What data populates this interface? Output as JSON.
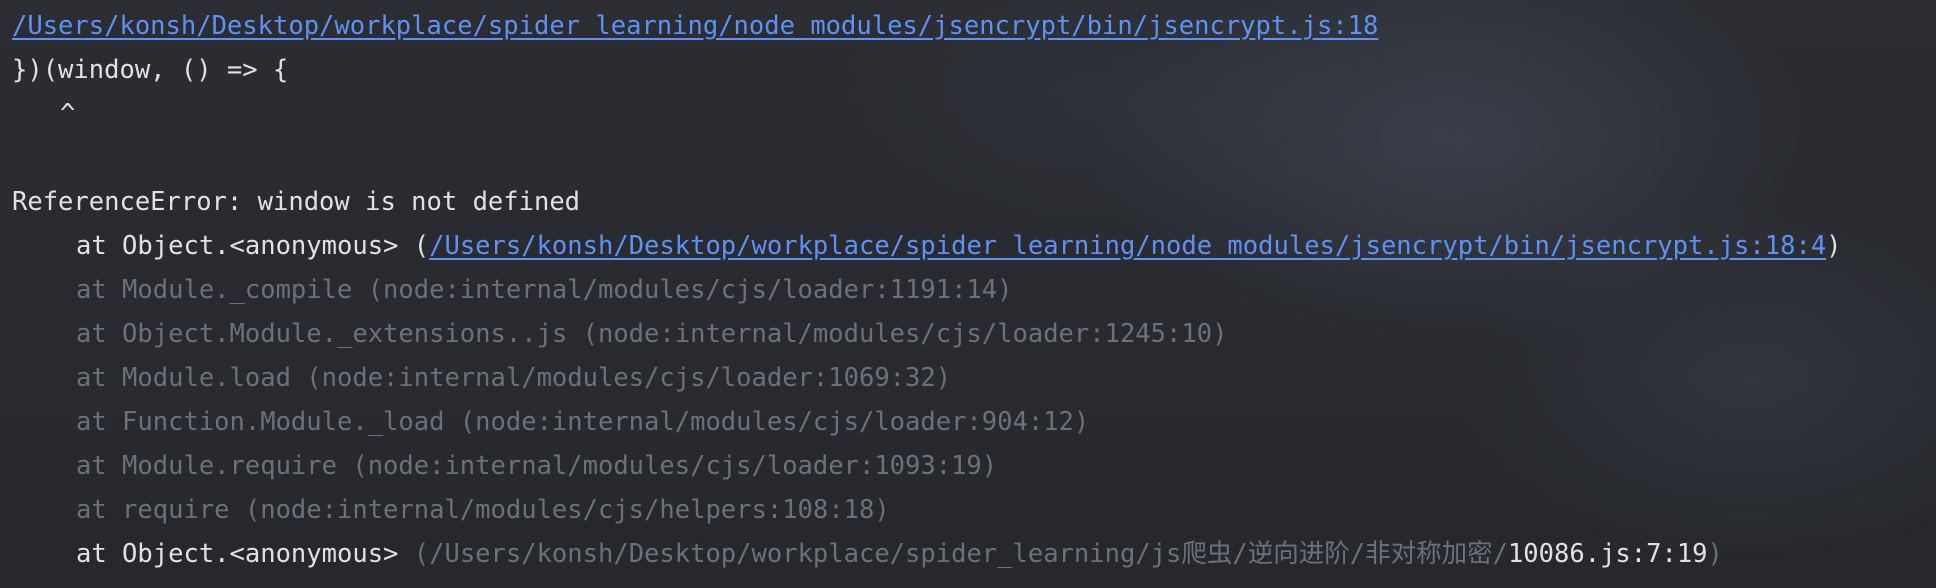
{
  "colors": {
    "background": "#2a2c31",
    "text": "#dfe1e5",
    "link": "#5d91f5",
    "dim": "#6c707a"
  },
  "console": {
    "error_location_link": "/Users/konsh/Desktop/workplace/spider_learning/node_modules/jsencrypt/bin/jsencrypt.js:18",
    "source_line": "})(window, () => {",
    "caret": "^",
    "error_message": "ReferenceError: window is not defined",
    "stack": [
      {
        "prefix": "at Object.<anonymous> (",
        "link": "/Users/konsh/Desktop/workplace/spider_learning/node_modules/jsencrypt/bin/jsencrypt.js:18:4",
        "suffix": ")"
      },
      {
        "text": "at Module._compile (node:internal/modules/cjs/loader:1191:14)"
      },
      {
        "text": "at Object.Module._extensions..js (node:internal/modules/cjs/loader:1245:10)"
      },
      {
        "text": "at Module.load (node:internal/modules/cjs/loader:1069:32)"
      },
      {
        "text": "at Function.Module._load (node:internal/modules/cjs/loader:904:12)"
      },
      {
        "text": "at Module.require (node:internal/modules/cjs/loader:1093:19)"
      },
      {
        "text": "at require (node:internal/modules/cjs/helpers:108:18)"
      },
      {
        "prefix": "at Object.<anonymous> ",
        "path_dim": "(/Users/konsh/Desktop/workplace/spider_learning/js爬虫/逆向进阶/非对称加密/",
        "path_file": "10086.js:7:19",
        "suffix": ")"
      }
    ]
  }
}
